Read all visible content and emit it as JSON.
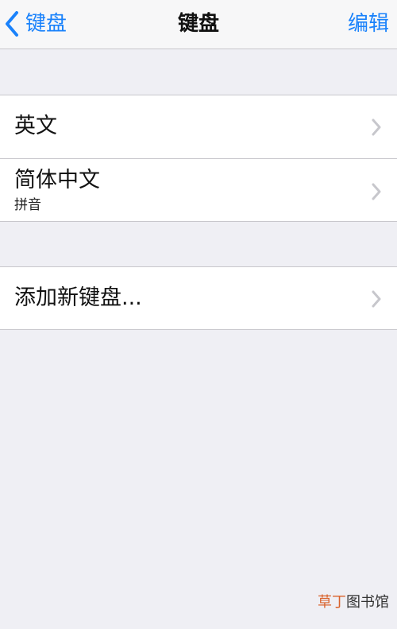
{
  "navbar": {
    "back_label": "键盘",
    "title": "键盘",
    "edit_label": "编辑"
  },
  "keyboards": [
    {
      "label": "英文",
      "sublabel": ""
    },
    {
      "label": "简体中文",
      "sublabel": "拼音"
    }
  ],
  "add_keyboard": {
    "label": "添加新键盘..."
  },
  "watermark": {
    "accent": "草丁",
    "rest": "图书馆"
  },
  "colors": {
    "accent": "#1a82fb",
    "background": "#efeff4",
    "separator": "#c8c7cc",
    "chevron": "#c7c7cc"
  }
}
